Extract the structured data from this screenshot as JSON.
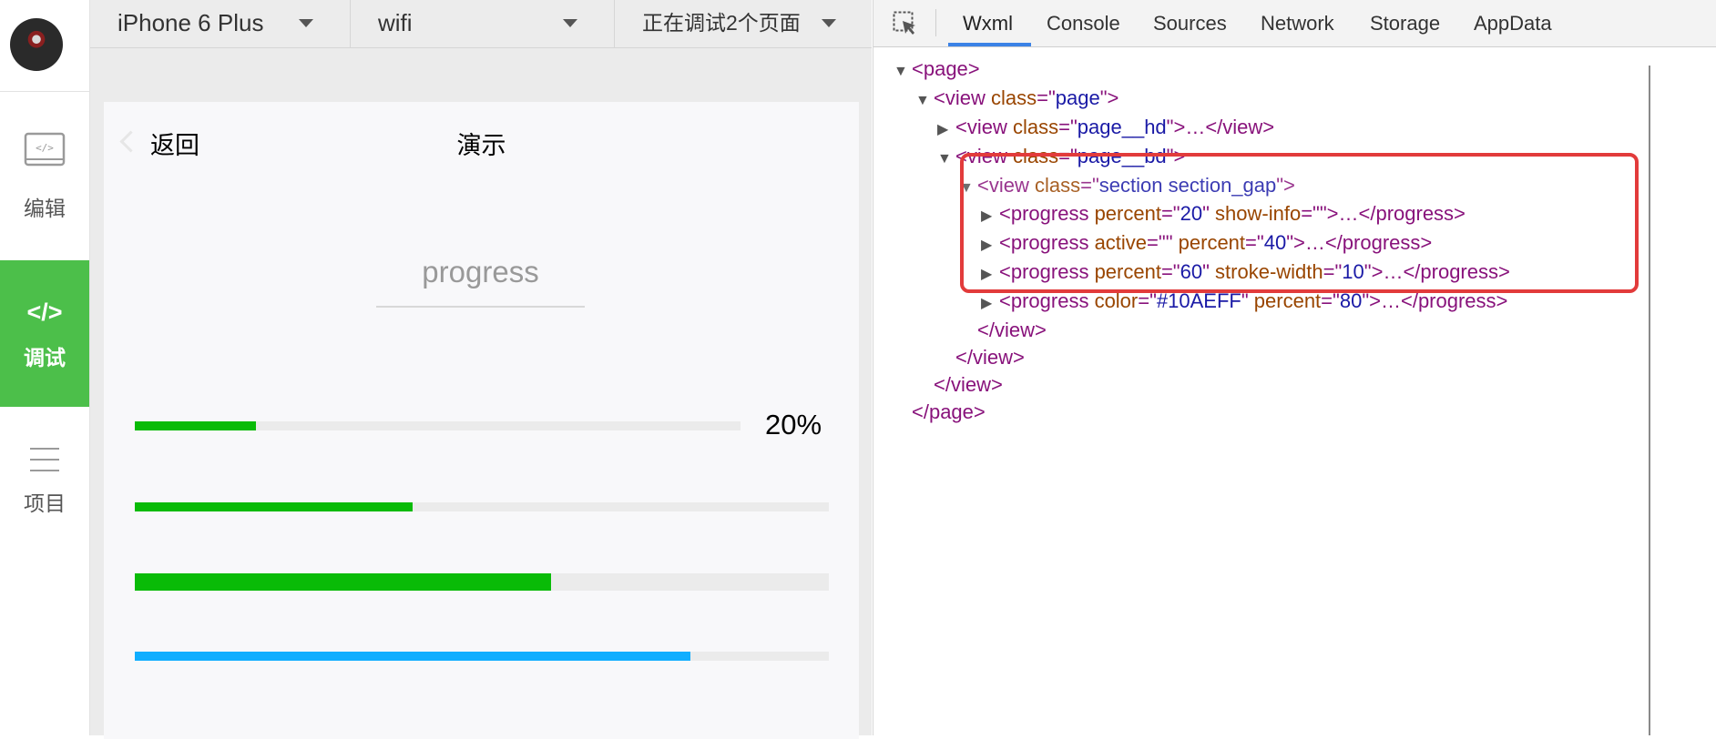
{
  "sidebar": {
    "items": [
      {
        "label": "编辑",
        "icon": "code-window-icon"
      },
      {
        "label": "调试",
        "icon": "code-brackets-icon",
        "glyph": "</>"
      },
      {
        "label": "项目",
        "icon": "menu-lines-icon"
      }
    ],
    "active_color": "#4cbf4a"
  },
  "simulator_bar": {
    "device": "iPhone 6 Plus",
    "network": "wifi",
    "pages": "正在调试2个页面"
  },
  "phone": {
    "back_label": "返回",
    "nav_title": "演示",
    "page_title": "progress",
    "progress_bars": [
      {
        "percent": 20,
        "color": "#09bb07",
        "show_info": true,
        "info": "20%"
      },
      {
        "percent": 40,
        "color": "#09bb07",
        "show_info": false
      },
      {
        "percent": 60,
        "color": "#09bb07",
        "show_info": false
      },
      {
        "percent": 80,
        "color": "#10AEFF",
        "show_info": false
      }
    ]
  },
  "devtools": {
    "tabs": [
      "Wxml",
      "Console",
      "Sources",
      "Network",
      "Storage",
      "AppData"
    ],
    "active_tab": "Wxml",
    "tree": [
      {
        "toggle": "▼",
        "parts": [
          [
            "tag",
            "<page>"
          ]
        ]
      },
      {
        "toggle": "▼",
        "parts": [
          [
            "tag",
            "<view "
          ],
          [
            "attr",
            " class"
          ],
          [
            "tag",
            "=\""
          ],
          [
            "val",
            "page"
          ],
          [
            "tag",
            "\">"
          ]
        ]
      },
      {
        "toggle": "▶",
        "parts": [
          [
            "tag",
            "<view "
          ],
          [
            "attr",
            " class"
          ],
          [
            "tag",
            "=\""
          ],
          [
            "val",
            "page__hd"
          ],
          [
            "tag",
            "\">…</view>"
          ]
        ]
      },
      {
        "toggle": "▼",
        "parts": [
          [
            "tag",
            "<view "
          ],
          [
            "attr",
            " class"
          ],
          [
            "tag",
            "=\""
          ],
          [
            "val",
            "page__bd"
          ],
          [
            "tag",
            "\">"
          ]
        ]
      },
      {
        "toggle": "▼",
        "parts": [
          [
            "tag",
            "<view "
          ],
          [
            "attr",
            " class"
          ],
          [
            "tag",
            "=\""
          ],
          [
            "val",
            "section section_gap"
          ],
          [
            "tag",
            "\">"
          ]
        ]
      },
      {
        "toggle": "▶",
        "parts": [
          [
            "tag",
            "<progress "
          ],
          [
            "attr",
            " percent"
          ],
          [
            "tag",
            "=\""
          ],
          [
            "val",
            "20"
          ],
          [
            "tag",
            "\" "
          ],
          [
            "attr",
            " show-info"
          ],
          [
            "tag",
            "=\"\">…</progress>"
          ]
        ]
      },
      {
        "toggle": "▶",
        "parts": [
          [
            "tag",
            "<progress "
          ],
          [
            "attr",
            " active"
          ],
          [
            "tag",
            "=\"\" "
          ],
          [
            "attr",
            " percent"
          ],
          [
            "tag",
            "=\""
          ],
          [
            "val",
            "40"
          ],
          [
            "tag",
            "\">…</progress>"
          ]
        ]
      },
      {
        "toggle": "▶",
        "parts": [
          [
            "tag",
            "<progress "
          ],
          [
            "attr",
            " percent"
          ],
          [
            "tag",
            "=\""
          ],
          [
            "val",
            "60"
          ],
          [
            "tag",
            "\" "
          ],
          [
            "attr",
            " stroke-width"
          ],
          [
            "tag",
            "=\""
          ],
          [
            "val",
            "10"
          ],
          [
            "tag",
            "\">…</progress>"
          ]
        ]
      },
      {
        "toggle": "▶",
        "parts": [
          [
            "tag",
            "<progress "
          ],
          [
            "attr",
            " color"
          ],
          [
            "tag",
            "=\""
          ],
          [
            "val",
            "#10AEFF"
          ],
          [
            "tag",
            "\" "
          ],
          [
            "attr",
            " percent"
          ],
          [
            "tag",
            "=\""
          ],
          [
            "val",
            "80"
          ],
          [
            "tag",
            "\">…</progress>"
          ]
        ]
      },
      {
        "toggle": "",
        "parts": [
          [
            "tag",
            "</view>"
          ]
        ]
      },
      {
        "toggle": "",
        "parts": [
          [
            "tag",
            "</view>"
          ]
        ]
      },
      {
        "toggle": "",
        "parts": [
          [
            "tag",
            "</view>"
          ]
        ]
      },
      {
        "toggle": "",
        "parts": [
          [
            "tag",
            "</page>"
          ]
        ]
      }
    ],
    "highlight_color": "#e23b3b"
  }
}
